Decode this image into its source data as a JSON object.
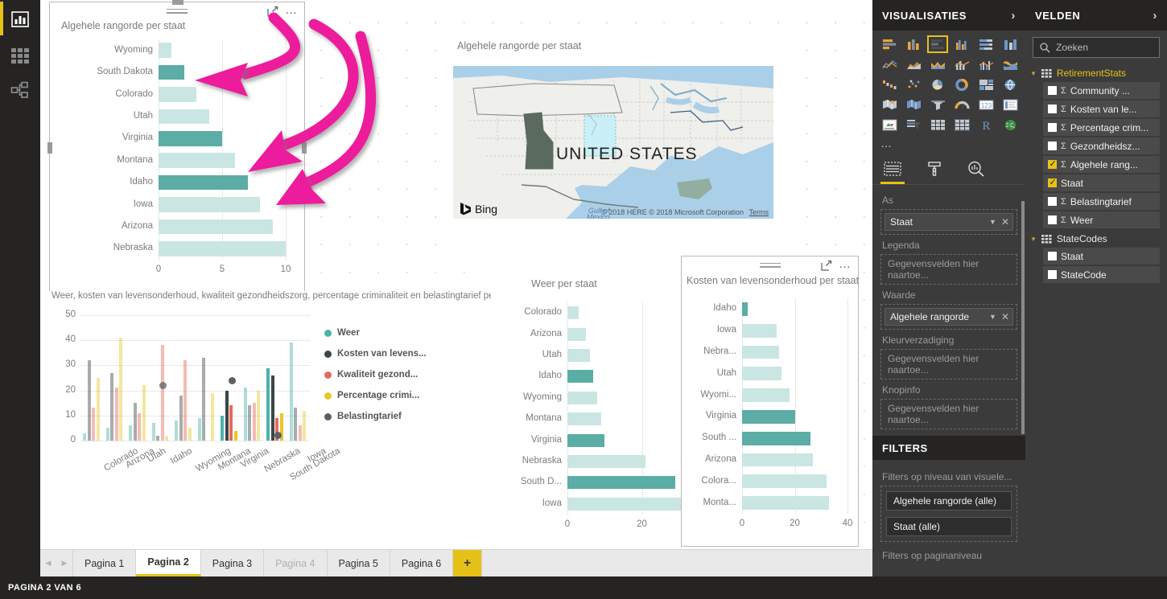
{
  "app": {
    "left_rail": [
      {
        "name": "report-view",
        "label": "Rapportweergave"
      },
      {
        "name": "data-view",
        "label": "Gegevensweergave"
      },
      {
        "name": "model-view",
        "label": "Modelweergave"
      }
    ],
    "status_bar": "PAGINA 2 VAN 6"
  },
  "tabs": {
    "items": [
      {
        "label": "Pagina 1",
        "active": false,
        "dim": false
      },
      {
        "label": "Pagina 2",
        "active": true,
        "dim": false
      },
      {
        "label": "Pagina 3",
        "active": false,
        "dim": false
      },
      {
        "label": "Pagina 4",
        "active": false,
        "dim": true
      },
      {
        "label": "Pagina 5",
        "active": false,
        "dim": false
      },
      {
        "label": "Pagina 6",
        "active": false,
        "dim": false
      }
    ],
    "add_label": "+"
  },
  "visualizations_panel": {
    "title": "VISUALISATIES",
    "chevron": "›",
    "more_icon": "…",
    "icons": [
      "stacked-bar-chart-icon",
      "stacked-column-chart-icon",
      "clustered-bar-chart-icon",
      "clustered-column-chart-icon",
      "100-stacked-bar-chart-icon",
      "100-stacked-column-chart-icon",
      "line-chart-icon",
      "area-chart-icon",
      "stacked-area-chart-icon",
      "line-stacked-column-chart-icon",
      "line-clustered-column-chart-icon",
      "ribbon-chart-icon",
      "waterfall-chart-icon",
      "scatter-chart-icon",
      "pie-chart-icon",
      "donut-chart-icon",
      "treemap-icon",
      "map-icon",
      "filled-map-icon",
      "shape-map-icon",
      "funnel-icon",
      "gauge-icon",
      "card-icon",
      "multi-row-card-icon",
      "kpi-icon",
      "slicer-icon",
      "table-icon",
      "matrix-icon",
      "r-script-icon",
      "arcgis-map-icon"
    ],
    "selected_icon_index": 2,
    "tabs": [
      {
        "name": "fields-tab",
        "icon": "fields-pane-icon",
        "active": true
      },
      {
        "name": "format-tab",
        "icon": "paint-roller-icon",
        "active": false
      },
      {
        "name": "analytics-tab",
        "icon": "magnifier-chart-icon",
        "active": false
      }
    ],
    "wells": [
      {
        "label": "As",
        "value": "Staat",
        "placeholder": null
      },
      {
        "label": "Legenda",
        "value": null,
        "placeholder": "Gegevensvelden hier naartoe..."
      },
      {
        "label": "Waarde",
        "value": "Algehele rangorde",
        "placeholder": null
      },
      {
        "label": "Kleurverzadiging",
        "value": null,
        "placeholder": "Gegevensvelden hier naartoe..."
      },
      {
        "label": "Knopinfo",
        "value": null,
        "placeholder": "Gegevensvelden hier naartoe..."
      }
    ]
  },
  "filters_panel": {
    "title": "FILTERS",
    "visual_level_label": "Filters op niveau van visuele...",
    "visual_filters": [
      "Algehele rangorde (alle)",
      "Staat (alle)"
    ],
    "page_level_label": "Filters op paginaniveau"
  },
  "fields_panel": {
    "title": "VELDEN",
    "chevron": "›",
    "search_placeholder": "Zoeken",
    "search_icon": "search-icon",
    "tables": [
      {
        "name": "RetirementStats",
        "highlight": true,
        "fields": [
          {
            "label": "Community ...",
            "checked": false,
            "measure": true
          },
          {
            "label": "Kosten van le...",
            "checked": false,
            "measure": true
          },
          {
            "label": "Percentage crim...",
            "checked": false,
            "measure": true
          },
          {
            "label": "Gezondheidsz...",
            "checked": false,
            "measure": true
          },
          {
            "label": "Algehele rang...",
            "checked": true,
            "measure": true
          },
          {
            "label": "Staat",
            "checked": true,
            "measure": false
          },
          {
            "label": "Belastingtarief",
            "checked": false,
            "measure": true
          },
          {
            "label": "Weer",
            "checked": false,
            "measure": true
          }
        ]
      },
      {
        "name": "StateCodes",
        "highlight": false,
        "fields": [
          {
            "label": "Staat",
            "checked": false,
            "measure": false
          },
          {
            "label": "StateCode",
            "checked": false,
            "measure": false
          }
        ]
      }
    ]
  },
  "colors": {
    "accent_yellow": "#e6c219",
    "teal_dark": "#5bada5",
    "teal_light": "#c9e6e2",
    "panel_bg": "#3b3b3b",
    "panel_header": "#252423",
    "arrow_pink": "#ec1e9c",
    "series_weer": "#4cb3a9",
    "series_kosten": "#3b4648",
    "series_kwaliteit": "#e8695a",
    "series_criminaliteit": "#e8c72b",
    "series_belasting": "#5a6163"
  },
  "chart_data": [
    {
      "id": "rank-bar-chart",
      "type": "bar",
      "title": "Algehele rangorde per staat",
      "xlabel": "",
      "ylabel": "",
      "xlim": [
        0,
        10
      ],
      "xticks": [
        "0",
        "5",
        "10"
      ],
      "categories": [
        "Wyoming",
        "South Dakota",
        "Colorado",
        "Utah",
        "Virginia",
        "Montana",
        "Idaho",
        "Iowa",
        "Arizona",
        "Nebraska"
      ],
      "values": [
        1,
        2,
        3,
        4,
        5,
        6,
        7,
        8,
        9,
        10
      ],
      "highlighted": [
        "South Dakota",
        "Virginia",
        "Idaho"
      ],
      "grid": true,
      "legend": "none"
    },
    {
      "id": "rank-map",
      "type": "map",
      "title": "Algehele rangorde per staat",
      "map_label": "UNITED STATES",
      "provider": "Bing",
      "attribution": "© 2018 HERE © 2018 Microsoft Corporation",
      "terms_label": "Terms",
      "gulf_label": "Gulf of Mexico",
      "highlighted_states": [
        "Idaho",
        "South Dakota",
        "Virginia"
      ]
    },
    {
      "id": "combo-column-chart",
      "type": "bar",
      "title": "Weer, kosten van levensonderhoud, kwaliteit gezondheidszorg, percentage criminaliteit en belastingtarief per staat",
      "ylim": [
        0,
        50
      ],
      "yticks": [
        "0",
        "10",
        "20",
        "30",
        "40",
        "50"
      ],
      "categories": [
        "Colorado",
        "Arizona",
        "Utah",
        "Idaho",
        "Wyoming",
        "Montana",
        "Virginia",
        "Nebraska",
        "South Dakota",
        "Iowa"
      ],
      "series": [
        {
          "name": "Weer",
          "color": "#4cb3a9",
          "values": [
            3,
            5,
            6,
            7,
            8,
            9,
            10,
            21,
            29,
            39
          ]
        },
        {
          "name": "Kosten van levens...",
          "color": "#3b4648",
          "values": [
            32,
            27,
            15,
            2,
            18,
            33,
            20,
            14,
            26,
            13
          ]
        },
        {
          "name": "Kwaliteit gezond...",
          "color": "#e8695a",
          "values": [
            13,
            21,
            11,
            38,
            32,
            0,
            14,
            15,
            9,
            6
          ]
        },
        {
          "name": "Percentage crimi...",
          "color": "#e8c72b",
          "values": [
            25,
            41,
            22,
            2,
            5,
            19,
            4,
            20,
            11,
            12
          ]
        },
        {
          "name": "Belastingtarief",
          "color": "#5a6163",
          "values": [
            null,
            null,
            null,
            22,
            null,
            null,
            24,
            null,
            2,
            null
          ],
          "marker": "dot"
        }
      ],
      "legend": "right",
      "grid": true
    },
    {
      "id": "weather-bar-chart",
      "type": "bar",
      "title": "Weer per staat",
      "xlim": [
        0,
        40
      ],
      "xticks": [
        "0",
        "20",
        "40"
      ],
      "categories": [
        "Colorado",
        "Arizona",
        "Utah",
        "Idaho",
        "Wyoming",
        "Montana",
        "Virginia",
        "Nebraska",
        "South D...",
        "Iowa"
      ],
      "values": [
        3,
        5,
        6,
        7,
        8,
        9,
        10,
        21,
        29,
        39
      ],
      "highlighted": [
        "Idaho",
        "Virginia",
        "South D..."
      ],
      "grid": true,
      "legend": "none"
    },
    {
      "id": "cost-bar-chart",
      "type": "bar",
      "title": "Kosten van levensonderhoud per staat",
      "xlim": [
        0,
        40
      ],
      "xticks": [
        "0",
        "20",
        "40"
      ],
      "categories": [
        "Idaho",
        "Iowa",
        "Nebra...",
        "Utah",
        "Wyomi...",
        "Virginia",
        "South ...",
        "Arizona",
        "Colora...",
        "Monta..."
      ],
      "values": [
        2,
        13,
        14,
        15,
        18,
        20,
        26,
        27,
        32,
        33
      ],
      "highlighted": [
        "Idaho",
        "Virginia",
        "South ..."
      ],
      "grid": true,
      "legend": "none"
    }
  ]
}
